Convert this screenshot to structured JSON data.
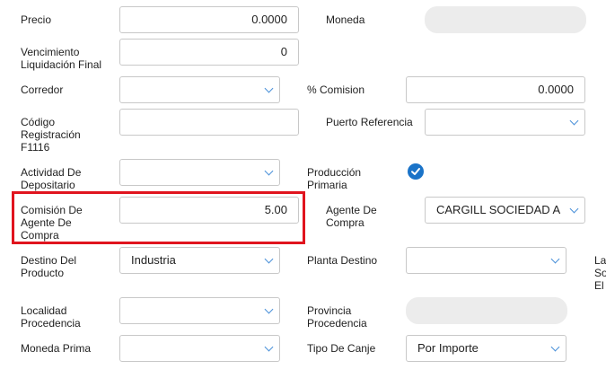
{
  "fields": {
    "precio": {
      "label": "Precio",
      "value": "0.0000"
    },
    "moneda": {
      "label": "Moneda",
      "value": ""
    },
    "vencimiento": {
      "label": "Vencimiento\nLiquidación Final",
      "value": "0"
    },
    "corredor": {
      "label": "Corredor",
      "value": ""
    },
    "pct_comision": {
      "label": "% Comision",
      "value": "0.0000"
    },
    "codigo_registracion": {
      "label": "Código\nRegistración\nF1116",
      "value": ""
    },
    "puerto_referencia": {
      "label": "Puerto Referencia",
      "value": ""
    },
    "actividad_depositario": {
      "label": "Actividad De\nDepositario",
      "value": ""
    },
    "produccion_primaria": {
      "label": "Producción\nPrimaria",
      "checked": true
    },
    "comision_agente": {
      "label": "Comisión De\nAgente De\nCompra",
      "value": "5.00"
    },
    "agente_compra": {
      "label": "Agente De\nCompra",
      "value": "CARGILL SOCIEDAD A"
    },
    "destino_producto": {
      "label": "Destino Del\nProducto",
      "value": "Industria"
    },
    "planta_destino": {
      "label": "Planta Destino",
      "value": ""
    },
    "cut_label": {
      "label": "La\nSo\nEl"
    },
    "localidad_procedencia": {
      "label": "Localidad\nProcedencia",
      "value": ""
    },
    "provincia_procedencia": {
      "label": "Provincia\nProcedencia",
      "value": ""
    },
    "moneda_prima": {
      "label": "Moneda Prima",
      "value": ""
    },
    "tipo_canje": {
      "label": "Tipo De Canje",
      "value": "Por Importe"
    }
  },
  "colors": {
    "highlight": "#e0141e",
    "accent": "#1a73c8",
    "chevron": "#4a90d9"
  },
  "icons": {
    "dropdown": "chevron-down-icon",
    "checkbox": "checkmark-icon"
  }
}
